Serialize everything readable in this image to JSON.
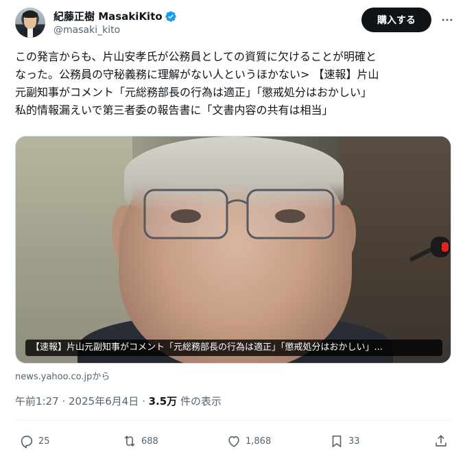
{
  "author": {
    "display_name": "紀藤正樹 MasakiKito",
    "handle": "@masaki_kito",
    "verified": true
  },
  "header": {
    "buy_button_label": "購入する"
  },
  "tweet": {
    "text_lines": [
      "この発言からも、片山安孝氏が公務員としての資質に欠けることが明確と",
      "なった。公務員の守秘義務に理解がない人というほかない> 【速報】片山",
      "元副知事がコメント「元総務部長の行為は適正」「懲戒処分はおかしい」",
      "私的情報漏えいで第三者委の報告書に「文書内容の共有は相当」"
    ]
  },
  "media": {
    "caption": "【速報】片山元副知事がコメント「元総務部長の行為は適正」「懲戒処分はおかしい」..."
  },
  "source": {
    "text": "news.yahoo.co.jpから"
  },
  "meta": {
    "time": "午前1:27",
    "separator": "·",
    "date": "2025年6月4日",
    "views_count": "3.5万",
    "views_label": "件の表示"
  },
  "actions": {
    "replies": "25",
    "reposts": "688",
    "likes": "1,868",
    "bookmarks": "33"
  },
  "colors": {
    "verified": "#1d9bf0",
    "text_primary": "#0f1419",
    "text_secondary": "#536471",
    "button_bg": "#0f1419"
  },
  "icons": [
    "verified-badge-icon",
    "more-icon",
    "reply-icon",
    "repost-icon",
    "like-icon",
    "bookmark-icon",
    "share-icon"
  ]
}
